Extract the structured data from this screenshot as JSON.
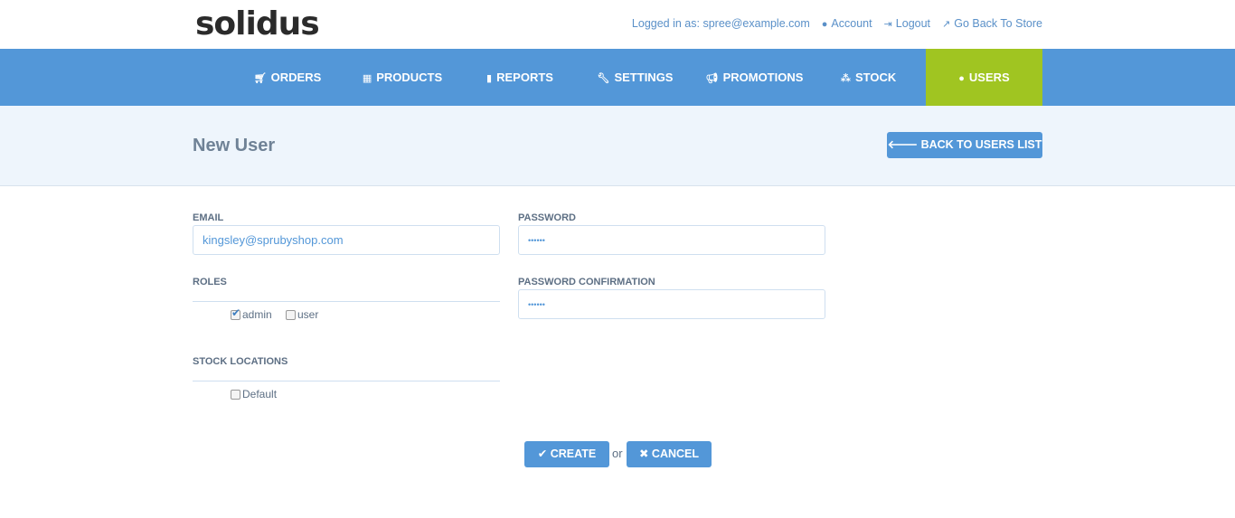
{
  "header": {
    "logo": "solidus",
    "logged_in": "Logged in as: spree@example.com",
    "account": "Account",
    "logout": "Logout",
    "store": "Go Back To Store"
  },
  "nav": [
    {
      "label": "Orders",
      "icon": "cart-icon"
    },
    {
      "label": "Products",
      "icon": "grid-icon"
    },
    {
      "label": "Reports",
      "icon": "file-icon"
    },
    {
      "label": "Settings",
      "icon": "wrench-icon"
    },
    {
      "label": "Promotions",
      "icon": "bullhorn-icon"
    },
    {
      "label": "Stock",
      "icon": "cubes-icon"
    },
    {
      "label": "Users",
      "icon": "user-icon",
      "active": true
    }
  ],
  "page": {
    "title": "New User",
    "back": "Back to Users List"
  },
  "form": {
    "email_label": "Email",
    "email_value": "kingsley@sprubyshop.com",
    "password_label": "Password",
    "password_value": "••••••",
    "confirm_label": "Password Confirmation",
    "confirm_value": "••••••",
    "roles_label": "Roles",
    "roles": [
      {
        "label": "admin",
        "checked": true
      },
      {
        "label": "user",
        "checked": false
      }
    ],
    "stock_label": "Stock Locations",
    "stock_locations": [
      {
        "label": "Default",
        "checked": false
      }
    ]
  },
  "actions": {
    "create": "Create",
    "or": "or",
    "cancel": "Cancel"
  },
  "colors": {
    "nav": "#5397d8",
    "active": "#a0c521"
  }
}
